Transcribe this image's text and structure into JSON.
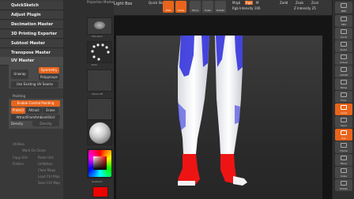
{
  "plugin_menu": {
    "items": [
      "QuickSketch",
      "Adjust Plugin",
      "Decimation Master",
      "3D Printing Exporter",
      "Subtool Master",
      "Transpose Master",
      "UV Master"
    ]
  },
  "uv_master": {
    "unwrap": "Unwrap",
    "symmetry": "Symmetry",
    "polygroups": "Polygroups",
    "use_existing": "Use Existing UV Seams",
    "painting_header": "Painting",
    "enable_control_painting": "Enable Control Painting",
    "protect": "Protect",
    "attract": "Attract",
    "erase": "Erase",
    "attract_ao": "AttractFromAmbientOccl",
    "density": "Density",
    "density_value": "Density",
    "utilities": "Utilities",
    "rows": [
      "Work On Clone",
      "Copy UVs",
      "Paste UVs",
      "Flatten",
      "Unflatten",
      "Clear Maps",
      "Load Ctrl Map",
      "Save Ctrl Map"
    ]
  },
  "thumbnails": {
    "brush_label": "Standard",
    "stroke_label": "Dots",
    "alpha_label": "Alpha Off",
    "texture_label": "Texture Off",
    "material_label": "MatCap",
    "gradient_label": "Gradient",
    "switch_label": "SwitchColor"
  },
  "topbar": {
    "projection_master": "Projection Master",
    "lightbox": "Light Box",
    "quick_sketch": "Quick Sketch",
    "edit": "Edit",
    "draw": "Draw",
    "move": "Move",
    "scale": "Scale",
    "rotate": "Rotate",
    "rgb_label": "Rgb",
    "mrgb": "Mrgb",
    "rgb": "Rgb",
    "m": "M",
    "zadd": "Zadd",
    "zsub": "Zsub",
    "zcut": "Zcut",
    "rgb_intensity": "Rgb Intensity 100",
    "z_intensity": "Z Intensity 25",
    "focal_shift": "Focal Shift 0",
    "draw_size": "Draw Size 64"
  },
  "shelf": {
    "buttons": [
      "BPR",
      "SPix",
      "Scroll",
      "Zoom",
      "Actual",
      "AAHalf",
      "Persp",
      "Floor",
      "Local",
      "LSym",
      "Xyz",
      "Frame",
      "Move",
      "Scale",
      "Rotate",
      "PolyF"
    ]
  }
}
